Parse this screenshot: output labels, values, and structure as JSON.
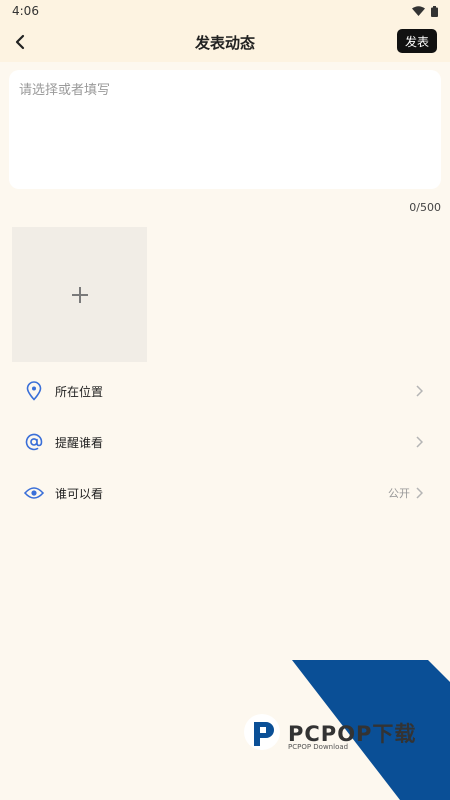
{
  "status_bar": {
    "time": "4:06"
  },
  "header": {
    "title": "发表动态",
    "publish_label": "发表"
  },
  "editor": {
    "placeholder": "请选择或者填写",
    "counter": "0/500"
  },
  "options": [
    {
      "label": "所在位置",
      "value": "",
      "icon": "location-pin-icon"
    },
    {
      "label": "提醒谁看",
      "value": "",
      "icon": "at-icon"
    },
    {
      "label": "谁可以看",
      "value": "公开",
      "icon": "eye-icon"
    }
  ],
  "watermark": {
    "brand": "PCPOP下载",
    "sub": "PCPOP Download"
  },
  "colors": {
    "accent_blue": "#3a6fd8",
    "header_bg": "#fdf3e1",
    "page_bg": "#fdf8ef",
    "watermark_blue": "#0a4f96"
  }
}
